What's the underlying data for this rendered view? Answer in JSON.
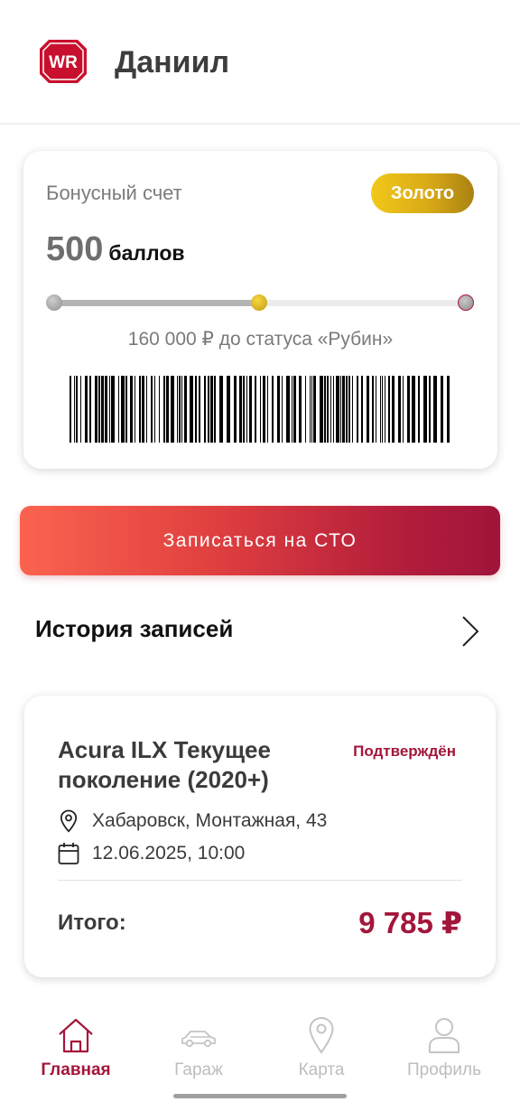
{
  "header": {
    "logo_text": "WR",
    "user_name": "Даниил"
  },
  "bonus": {
    "title": "Бонусный счет",
    "status": "Золото",
    "points_value": "500",
    "points_unit": "баллов",
    "progress_fraction": 0.5,
    "progress_caption": "160 000 ₽ до статуса «Рубин»",
    "colors": {
      "gold": "#d9aa16",
      "next_level_ring": "#b01a3c"
    }
  },
  "actions": {
    "book_label": "Записаться на СТО"
  },
  "history": {
    "title": "История записей",
    "records": [
      {
        "car": "Acura ILX Текущее поколение (2020+)",
        "status": "Подтверждён",
        "address": "Хабаровск, Монтажная, 43",
        "datetime": "12.06.2025, 10:00",
        "total_label": "Итого:",
        "total_value": "9 785 ₽"
      }
    ]
  },
  "tabbar": {
    "items": [
      {
        "label": "Главная",
        "icon": "home-icon",
        "active": true
      },
      {
        "label": "Гараж",
        "icon": "car-icon",
        "active": false
      },
      {
        "label": "Карта",
        "icon": "map-pin-icon",
        "active": false
      },
      {
        "label": "Профиль",
        "icon": "user-icon",
        "active": false
      }
    ]
  },
  "theme": {
    "accent": "#a3163b",
    "button_gradient_start": "#fb634f",
    "button_gradient_end": "#a0143a"
  }
}
